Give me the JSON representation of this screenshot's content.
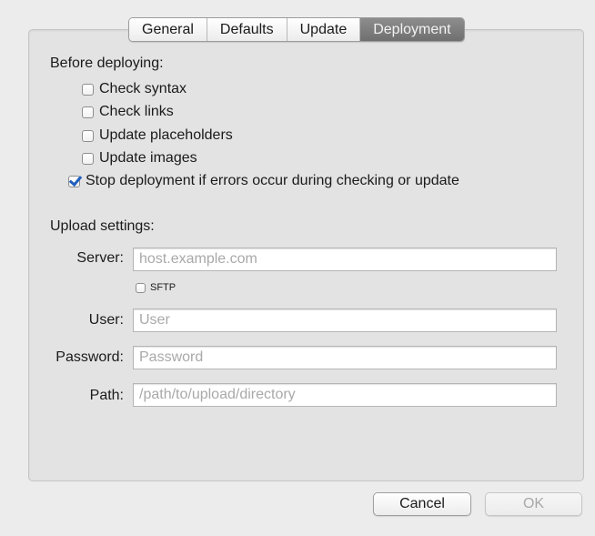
{
  "tabs": [
    {
      "label": "General",
      "active": false
    },
    {
      "label": "Defaults",
      "active": false
    },
    {
      "label": "Update",
      "active": false
    },
    {
      "label": "Deployment",
      "active": true
    }
  ],
  "before_deploying": {
    "heading": "Before deploying:",
    "options": [
      {
        "label": "Check syntax",
        "checked": false
      },
      {
        "label": "Check links",
        "checked": false
      },
      {
        "label": "Update placeholders",
        "checked": false
      },
      {
        "label": "Update images",
        "checked": false
      }
    ],
    "stop_option": {
      "label": "Stop deployment if errors occur during checking or update",
      "checked": true
    }
  },
  "upload": {
    "heading": "Upload settings:",
    "server": {
      "label": "Server:",
      "placeholder": "host.example.com",
      "value": ""
    },
    "sftp": {
      "label": "SFTP",
      "checked": false
    },
    "user": {
      "label": "User:",
      "placeholder": "User",
      "value": ""
    },
    "password": {
      "label": "Password:",
      "placeholder": "Password",
      "value": ""
    },
    "path": {
      "label": "Path:",
      "placeholder": "/path/to/upload/directory",
      "value": ""
    }
  },
  "buttons": {
    "cancel": "Cancel",
    "ok": "OK"
  },
  "colors": {
    "window_bg": "#ececec",
    "panel_bg": "#e3e3e3",
    "active_tab": "#7d7d7d",
    "checkmark": "#1f5fbf"
  }
}
